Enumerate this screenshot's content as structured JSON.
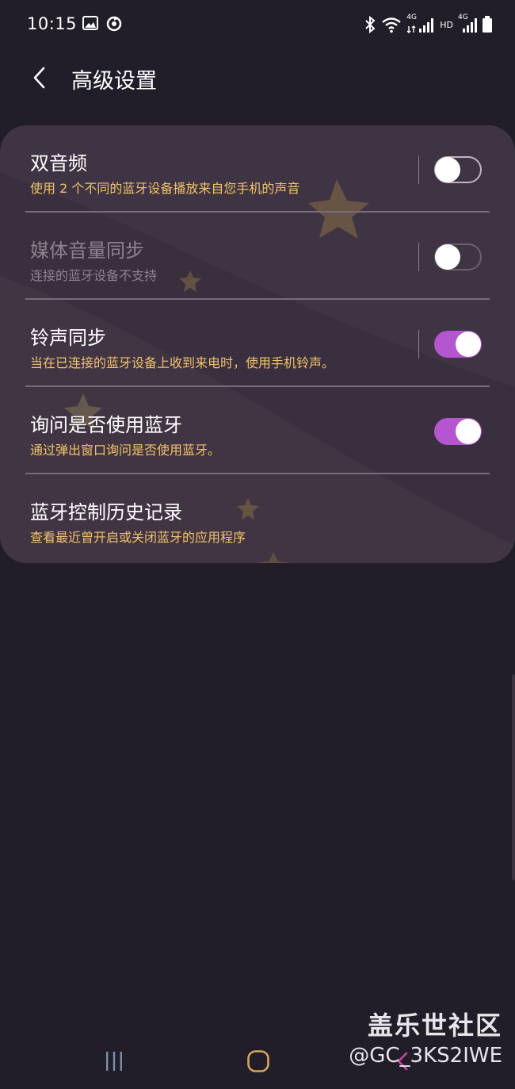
{
  "status_bar": {
    "time": "10:15",
    "left_icons": [
      "image-icon",
      "sync-icon"
    ],
    "right_icons": [
      "bluetooth-icon",
      "wifi-icon",
      "signal-4g-icon",
      "hd-signal-icon",
      "battery-icon"
    ],
    "network_label": "4G",
    "hd_label": "HD"
  },
  "header": {
    "title": "高级设置"
  },
  "settings": [
    {
      "title": "双音频",
      "subtitle": "使用 2 个不同的蓝牙设备播放来自您手机的声音",
      "toggle": "off",
      "enabled": true
    },
    {
      "title": "媒体音量同步",
      "subtitle": "连接的蓝牙设备不支持",
      "toggle": "off",
      "enabled": false
    },
    {
      "title": "铃声同步",
      "subtitle": "当在已连接的蓝牙设备上收到来电时，使用手机铃声。",
      "toggle": "on",
      "enabled": true
    },
    {
      "title": "询问是否使用蓝牙",
      "subtitle": "通过弹出窗口询问是否使用蓝牙。",
      "toggle": "on",
      "enabled": true
    },
    {
      "title": "蓝牙控制历史记录",
      "subtitle": "查看最近曾开启或关闭蓝牙的应用程序",
      "toggle": null,
      "enabled": true
    }
  ],
  "watermark": {
    "site": "盖乐世社区",
    "user": "@GC_3KS2IWE"
  },
  "nav_bar": {
    "buttons": [
      "recents-icon",
      "home-icon",
      "back-icon"
    ]
  },
  "colors": {
    "background": "#221e29",
    "card": "#3f3443",
    "subtitle": "#f1c26a",
    "toggle_on": "#b555cf",
    "watermark_accent": "#c04a9a"
  }
}
